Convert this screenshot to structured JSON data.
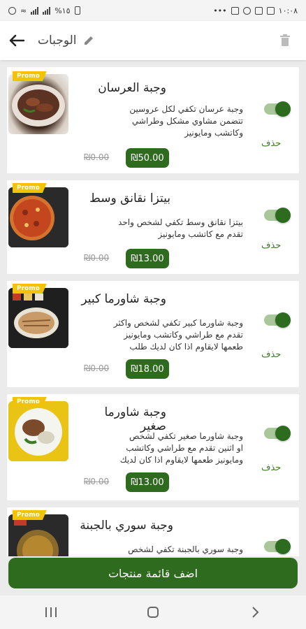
{
  "status": {
    "time": "١٠:٠٨",
    "battery": "%١٥",
    "dots": "•••"
  },
  "header": {
    "title": "الوجبات"
  },
  "items": [
    {
      "title": "وجبة العرسان",
      "desc_lines": [
        "وجبة عرسان تكفي لكل عروسين",
        "تتضمن مشاوي مشكل وطراشي",
        "وكاتشب ومايونيز"
      ],
      "price": "₪50.00",
      "old_price": "₪0.00",
      "delete": "حذف",
      "promo": "Promo",
      "enabled": true
    },
    {
      "title": "بيتزا نقانق وسط",
      "desc_lines": [
        "بيتزا نقانق وسط تكفي لشخص واحد",
        "تقدم مع كاتشب ومايونيز"
      ],
      "price": "₪13.00",
      "old_price": "₪0.00",
      "delete": "حذف",
      "promo": "Promo",
      "enabled": true
    },
    {
      "title": "وجبة شاورما كبير",
      "desc_lines": [
        "وجبة شاورما كبير تكفي لشخص واكثر",
        "تقدم مع طراشي وكاتشب ومايونيز",
        "طعمها لايقاوم اذا كان لديك طلب"
      ],
      "price": "₪18.00",
      "old_price": "₪0.00",
      "delete": "حذف",
      "promo": "Promo",
      "enabled": true
    },
    {
      "title": "وجبة شاورما صغير",
      "desc_lines": [
        "وجبة شاورما صغير تكفي لشخص",
        "او اثنين تقدم مع طراشي وكاتشب",
        "ومايونيز طعمها لايقاوم اذا كان لديك"
      ],
      "price": "₪13.00",
      "old_price": "₪0.00",
      "delete": "حذف",
      "promo": "Promo",
      "enabled": true
    },
    {
      "title": "وجبة سوري بالجبنة",
      "desc_lines": [
        "وجبة سوري بالجبنة تكفي لشخص"
      ],
      "price": "",
      "old_price": "",
      "delete": "",
      "promo": "Promo",
      "enabled": true
    }
  ],
  "footer": {
    "add_button": "اضف قائمة منتجات"
  },
  "colors": {
    "primary": "#2f6b1f",
    "promo": "#f2c400",
    "toggle_track": "#a9c79a"
  },
  "icons": {
    "back": "arrow-left-icon",
    "edit": "pencil-icon",
    "delete": "trash-icon",
    "nav_recent": "recent-apps-icon",
    "nav_home": "home-icon",
    "nav_back": "nav-back-icon"
  }
}
